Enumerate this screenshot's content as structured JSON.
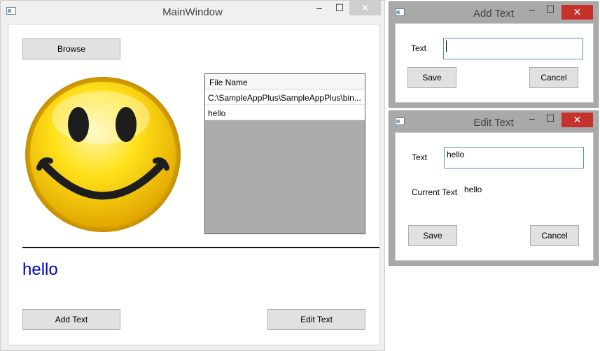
{
  "main_window": {
    "title": "MainWindow",
    "browse_label": "Browse",
    "file_list": {
      "header": "File Name",
      "rows": [
        "C:\\SampleAppPlus\\SampleAppPlus\\bin...",
        "hello"
      ]
    },
    "display_text": "hello",
    "add_text_label": "Add Text",
    "edit_text_label": "Edit Text",
    "minimize_glyph": "‒",
    "maximize_glyph": "☐",
    "close_glyph": "✕"
  },
  "add_text_dialog": {
    "title": "Add Text",
    "text_label": "Text",
    "text_value": "",
    "save_label": "Save",
    "cancel_label": "Cancel"
  },
  "edit_text_dialog": {
    "title": "Edit Text",
    "text_label": "Text",
    "text_value": "hello",
    "current_text_label": "Current Text",
    "current_text_value": "hello",
    "save_label": "Save",
    "cancel_label": "Cancel"
  },
  "colors": {
    "accent_text": "#0000cc",
    "close_active": "#c7312b",
    "input_border": "#5b8fc9"
  },
  "icons": [
    "window-app-icon",
    "smiley-face-icon"
  ]
}
